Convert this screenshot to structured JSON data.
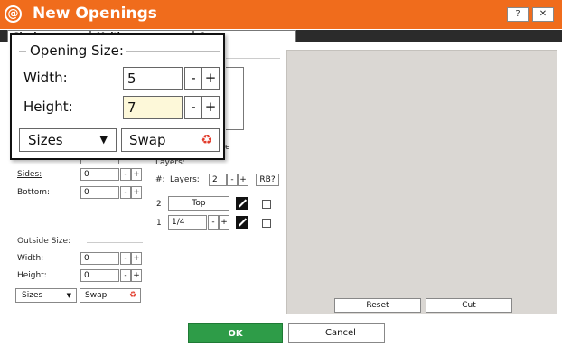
{
  "window": {
    "title": "New Openings",
    "logo_glyph": "@",
    "help_btn": "?",
    "close_btn": "✕",
    "accent": "#f06c1c"
  },
  "tabs": [
    "Single",
    "Multi",
    "Away"
  ],
  "inside": {
    "sides_label": "Sides:",
    "sides_value": "0",
    "bottom_label": "Bottom:",
    "bottom_value": "0",
    "fragment_e": "e"
  },
  "outside": {
    "section_label": "Outside Size:",
    "width_label": "Width:",
    "width_value": "0",
    "height_label": "Height:",
    "height_value": "0",
    "sizes_label": "Sizes",
    "swap_label": "Swap"
  },
  "layers": {
    "section_label": "Layers:",
    "count_prefix": "#:",
    "count_label": "Layers:",
    "count_value": "2",
    "rb_label": "RB?",
    "rows": [
      {
        "num": "2",
        "value": "Top"
      },
      {
        "num": "1",
        "value": "1/4"
      }
    ]
  },
  "stepper": {
    "minus": "-",
    "plus": "+"
  },
  "preview": {
    "reset_label": "Reset",
    "cut_label": "Cut"
  },
  "footer": {
    "ok_label": "OK",
    "cancel_label": "Cancel",
    "ok_color": "#2e9c48"
  },
  "zoom": {
    "title": "Opening Size:",
    "width_label": "Width:",
    "width_value": "5",
    "height_label": "Height:",
    "height_value": "7",
    "sizes_label": "Sizes",
    "swap_label": "Swap"
  }
}
